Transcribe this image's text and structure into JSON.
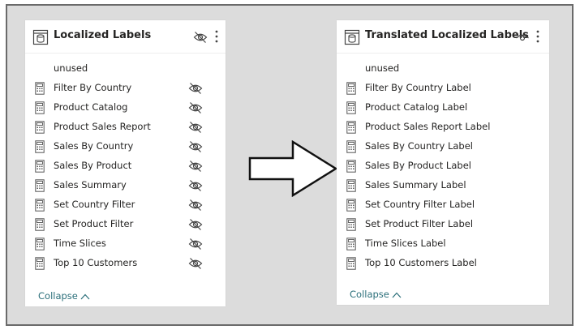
{
  "left_table": {
    "title": "Localized Labels",
    "fields": [
      {
        "label": "unused",
        "has_icon": false,
        "hidden": false
      },
      {
        "label": "Filter By Country",
        "has_icon": true,
        "hidden": true
      },
      {
        "label": "Product Catalog",
        "has_icon": true,
        "hidden": true
      },
      {
        "label": "Product Sales Report",
        "has_icon": true,
        "hidden": true
      },
      {
        "label": "Sales By Country",
        "has_icon": true,
        "hidden": true
      },
      {
        "label": "Sales By Product",
        "has_icon": true,
        "hidden": true
      },
      {
        "label": "Sales Summary",
        "has_icon": true,
        "hidden": true
      },
      {
        "label": "Set Country Filter",
        "has_icon": true,
        "hidden": true
      },
      {
        "label": "Set Product Filter",
        "has_icon": true,
        "hidden": true
      },
      {
        "label": "Time Slices",
        "has_icon": true,
        "hidden": true
      },
      {
        "label": "Top 10 Customers",
        "has_icon": true,
        "hidden": true
      }
    ],
    "collapse_label": "Collapse",
    "header_visibility_icon": "eye-slash-icon"
  },
  "right_table": {
    "title": "Translated Localized Labels",
    "fields": [
      {
        "label": "unused",
        "has_icon": false,
        "hidden": false
      },
      {
        "label": "Filter By Country Label",
        "has_icon": true,
        "hidden": false
      },
      {
        "label": "Product Catalog Label",
        "has_icon": true,
        "hidden": false
      },
      {
        "label": "Product Sales Report Label",
        "has_icon": true,
        "hidden": false
      },
      {
        "label": "Sales By Country Label",
        "has_icon": true,
        "hidden": false
      },
      {
        "label": "Sales By Product Label",
        "has_icon": true,
        "hidden": false
      },
      {
        "label": "Sales Summary Label",
        "has_icon": true,
        "hidden": false
      },
      {
        "label": "Set Country Filter Label",
        "has_icon": true,
        "hidden": false
      },
      {
        "label": "Set Product Filter Label",
        "has_icon": true,
        "hidden": false
      },
      {
        "label": "Time Slices Label",
        "has_icon": true,
        "hidden": false
      },
      {
        "label": "Top 10 Customers Label",
        "has_icon": true,
        "hidden": false
      }
    ],
    "collapse_label": "Collapse",
    "header_visibility_icon": "eye-icon"
  },
  "colors": {
    "canvas": "#dcdcdc",
    "card": "#ffffff",
    "text": "#252423",
    "link": "#2b6f7a",
    "icon": "#555555"
  },
  "icons": {
    "table": "table-icon",
    "field": "calculator-icon",
    "hidden": "eye-slash-icon",
    "more": "more-vertical-icon",
    "collapse": "chevron-up-icon",
    "transform": "right-arrow-icon"
  }
}
